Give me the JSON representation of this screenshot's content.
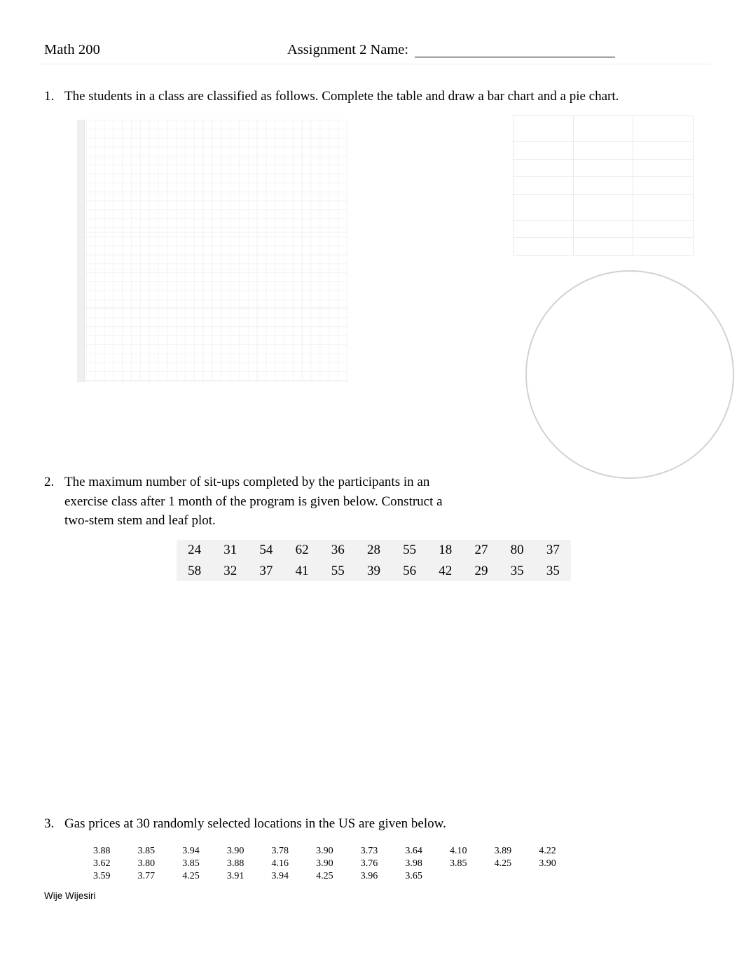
{
  "header": {
    "course": "Math 200",
    "assignment": "Assignment 2  Name:",
    "name_value": ""
  },
  "questions": [
    {
      "number": "1.",
      "text": "The students in a class are classified as follows. Complete the table and draw a bar chart and a pie chart."
    },
    {
      "number": "2.",
      "line1": "The maximum number of sit-ups completed by the participants in an",
      "line2": "exercise class after 1 month of the program is given below. Construct a",
      "line3": "two-stem   stem and leaf plot."
    },
    {
      "number": "3.",
      "text": "Gas prices at 30 randomly selected locations in the US are given below."
    }
  ],
  "situps_data": {
    "rows": [
      [
        "24",
        "31",
        "54",
        "62",
        "36",
        "28",
        "55",
        "18",
        "27",
        "80",
        "37"
      ],
      [
        "58",
        "32",
        "37",
        "41",
        "55",
        "39",
        "56",
        "42",
        "29",
        "35",
        "35"
      ]
    ]
  },
  "gas_prices": {
    "rows": [
      [
        "3.88",
        "3.85",
        "3.94",
        "3.90",
        "3.78",
        "3.90",
        "3.73",
        "3.64",
        "4.10",
        "3.89",
        "4.22"
      ],
      [
        "3.62",
        "3.80",
        "3.85",
        "3.88",
        "4.16",
        "3.90",
        "3.76",
        "3.98",
        "3.85",
        "4.25",
        "3.90"
      ],
      [
        "3.59",
        "3.77",
        "4.25",
        "3.91",
        "3.94",
        "4.25",
        "3.96",
        "3.65",
        "",
        "",
        ""
      ]
    ]
  },
  "blank_table": {
    "rows": [
      [
        "",
        "",
        ""
      ],
      [
        "",
        "",
        ""
      ],
      [
        "",
        "",
        ""
      ],
      [
        "",
        "",
        ""
      ],
      [
        "",
        "",
        ""
      ],
      [
        "",
        "",
        ""
      ],
      [
        "",
        "",
        ""
      ]
    ]
  },
  "footer": {
    "author": "Wije Wijesiri"
  },
  "colors": {
    "page_background": "#ffffff",
    "text": "#000000",
    "grid_line": "#f3f3f3",
    "grid_major": "#ededed",
    "table_border": "#e9e9e9",
    "circle_stroke": "#d2d2d2",
    "data_block_background": "#f2f2f2",
    "header_rule": "#ededed"
  }
}
